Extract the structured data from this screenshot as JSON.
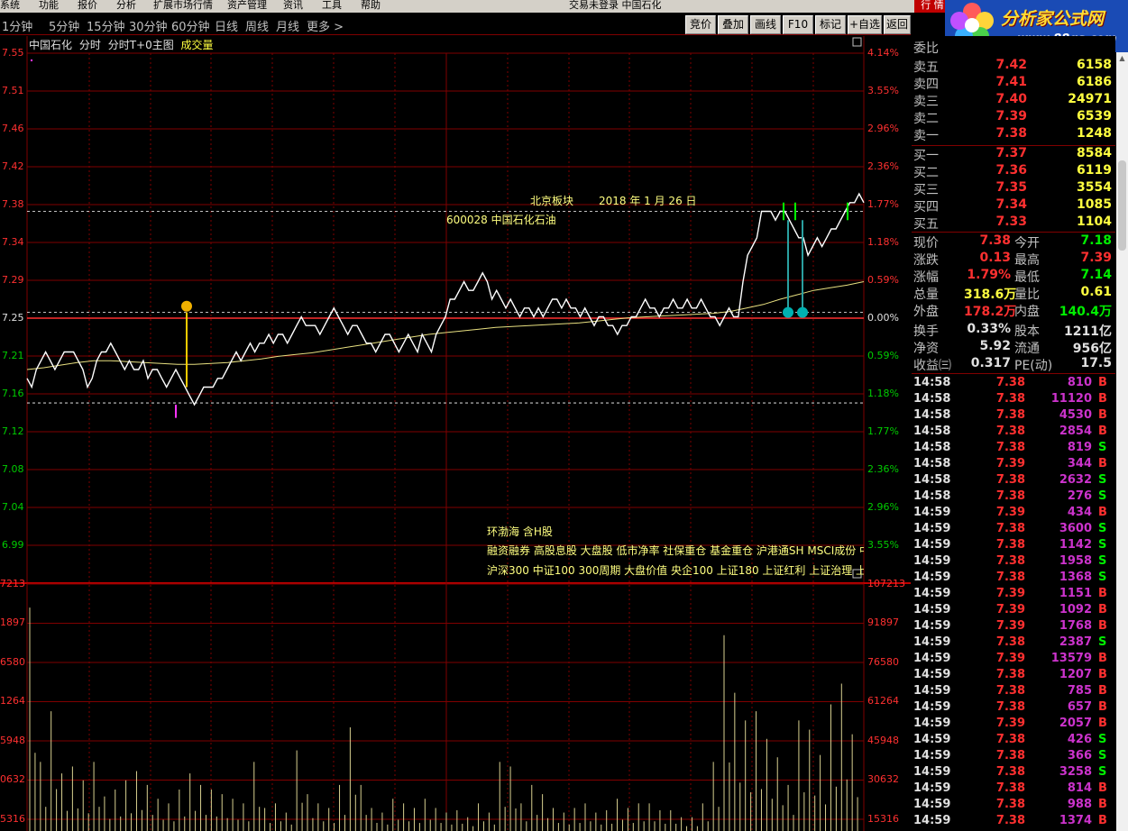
{
  "menu": [
    "系统",
    "功能",
    "报价",
    "分析",
    "扩展市场行情",
    "资产管理",
    "资讯",
    "工具",
    "帮助"
  ],
  "app_title": "交易未登录  中国石化",
  "xingqing_label": "行 情",
  "logo": {
    "text": "分析家公式网",
    "url": "www.88gs.com"
  },
  "toolbar": {
    "periods": [
      "1分钟",
      "5分钟",
      "15分钟",
      "30分钟",
      "60分钟",
      "日线",
      "周线",
      "月线",
      "更多 >"
    ],
    "buttons": [
      "竞价",
      "叠加",
      "画线",
      "F10",
      "标记",
      "+自选",
      "返回"
    ]
  },
  "chart_title": {
    "stock": "中国石化",
    "mode1": "分时",
    "mode2": "分时T+0主图",
    "indicator": "成交量"
  },
  "price_axis": {
    "left": [
      "7.55",
      "7.51",
      "7.46",
      "7.42",
      "7.38",
      "7.34",
      "7.29",
      "7.25",
      "7.21",
      "7.16",
      "7.12",
      "7.08",
      "7.04",
      "6.99"
    ],
    "right": [
      "4.14%",
      "3.55%",
      "2.96%",
      "2.36%",
      "1.77%",
      "1.18%",
      "0.59%",
      "0.00%",
      "0.59%",
      "1.18%",
      "1.77%",
      "2.36%",
      "2.96%",
      "3.55%"
    ]
  },
  "volume_axis": {
    "left": [
      "7213",
      "1897",
      "6580",
      "1264",
      "5948",
      "0632",
      "5316"
    ],
    "right": [
      "107213",
      "91897",
      "76580",
      "61264",
      "45948",
      "30632",
      "15316"
    ]
  },
  "annotations": {
    "beijing": "北京板块",
    "date": "2018 年 1 月 26 日",
    "code": "600028 中国石化石油",
    "sector1": "环渤海 含H股",
    "sector2": "融资融券 高股息股 大盘股 低市净率 社保重仓 基金重仓 沪港通SH MSCI成份 中",
    "sector3": "沪深300 中证100 300周期 大盘价值 央企100 上证180 上证红利 上证治理 上证"
  },
  "chart_data": {
    "type": "line",
    "price_range": [
      6.99,
      7.55
    ],
    "pre_close": 7.25,
    "price": [
      7.18,
      7.17,
      7.19,
      7.2,
      7.21,
      7.2,
      7.19,
      7.2,
      7.21,
      7.21,
      7.21,
      7.2,
      7.19,
      7.17,
      7.18,
      7.2,
      7.21,
      7.21,
      7.22,
      7.21,
      7.2,
      7.19,
      7.2,
      7.19,
      7.19,
      7.2,
      7.18,
      7.19,
      7.19,
      7.18,
      7.17,
      7.18,
      7.19,
      7.18,
      7.17,
      7.16,
      7.15,
      7.16,
      7.17,
      7.17,
      7.17,
      7.18,
      7.18,
      7.19,
      7.2,
      7.21,
      7.2,
      7.21,
      7.22,
      7.21,
      7.22,
      7.22,
      7.23,
      7.22,
      7.23,
      7.23,
      7.22,
      7.23,
      7.24,
      7.25,
      7.24,
      7.24,
      7.24,
      7.23,
      7.24,
      7.25,
      7.26,
      7.25,
      7.24,
      7.23,
      7.24,
      7.24,
      7.23,
      7.22,
      7.22,
      7.21,
      7.22,
      7.23,
      7.23,
      7.22,
      7.21,
      7.22,
      7.23,
      7.22,
      7.21,
      7.23,
      7.22,
      7.21,
      7.23,
      7.24,
      7.25,
      7.27,
      7.27,
      7.28,
      7.29,
      7.28,
      7.28,
      7.29,
      7.3,
      7.29,
      7.27,
      7.28,
      7.27,
      7.26,
      7.27,
      7.26,
      7.25,
      7.26,
      7.26,
      7.25,
      7.26,
      7.25,
      7.26,
      7.27,
      7.27,
      7.26,
      7.27,
      7.26,
      7.26,
      7.25,
      7.26,
      7.25,
      7.24,
      7.25,
      7.25,
      7.24,
      7.24,
      7.23,
      7.24,
      7.24,
      7.25,
      7.25,
      7.26,
      7.27,
      7.26,
      7.26,
      7.25,
      7.26,
      7.26,
      7.27,
      7.26,
      7.26,
      7.27,
      7.26,
      7.26,
      7.27,
      7.26,
      7.25,
      7.25,
      7.24,
      7.25,
      7.26,
      7.25,
      7.25,
      7.29,
      7.32,
      7.33,
      7.34,
      7.37,
      7.37,
      7.37,
      7.36,
      7.37,
      7.37,
      7.36,
      7.35,
      7.34,
      7.34,
      7.32,
      7.33,
      7.34,
      7.33,
      7.34,
      7.35,
      7.35,
      7.36,
      7.37,
      7.38,
      7.38,
      7.39,
      7.38
    ],
    "avg_price": [
      7.19,
      7.192,
      7.195,
      7.198,
      7.2,
      7.2,
      7.199,
      7.198,
      7.197,
      7.196,
      7.196,
      7.197,
      7.198,
      7.2,
      7.202,
      7.205,
      7.207,
      7.209,
      7.212,
      7.215,
      7.218,
      7.221,
      7.224,
      7.227,
      7.23,
      7.232,
      7.234,
      7.236,
      7.238,
      7.239,
      7.24,
      7.241,
      7.242,
      7.243,
      7.245,
      7.247,
      7.249,
      7.25,
      7.251,
      7.252,
      7.253,
      7.254,
      7.256,
      7.26,
      7.264,
      7.27,
      7.275,
      7.28,
      7.283,
      7.286,
      7.29
    ],
    "volume_max": 107213,
    "volume_peaks": [
      97000,
      30000,
      52000,
      25000,
      28000,
      22000,
      30000,
      15000,
      18000,
      22000,
      26000,
      20000,
      14000,
      12000,
      18000,
      25000,
      20000,
      18000,
      16000,
      14000,
      12000,
      30000,
      10000,
      12000,
      8000,
      35000,
      16000,
      12000,
      10000,
      20000,
      45000,
      20000,
      10000,
      8000,
      14000,
      12000,
      10000,
      14000,
      10000,
      8000,
      9000,
      6000,
      12000,
      8000,
      30000,
      28000,
      12000,
      20000,
      16000,
      10000,
      8000,
      10000,
      12000,
      8000,
      9000,
      14000,
      10000,
      12000,
      12000,
      9000,
      9000,
      6000,
      6000,
      12000,
      30000,
      85000,
      60000,
      48000,
      52000,
      40000,
      32000,
      20000,
      48000,
      44000,
      33000,
      55000,
      64000,
      42000
    ]
  },
  "order_book": {
    "header": "委比",
    "sell": [
      {
        "label": "卖五",
        "price": "7.42",
        "vol": "6158"
      },
      {
        "label": "卖四",
        "price": "7.41",
        "vol": "6186"
      },
      {
        "label": "卖三",
        "price": "7.40",
        "vol": "24971"
      },
      {
        "label": "卖二",
        "price": "7.39",
        "vol": "6539"
      },
      {
        "label": "卖一",
        "price": "7.38",
        "vol": "1248"
      }
    ],
    "buy": [
      {
        "label": "买一",
        "price": "7.37",
        "vol": "8584"
      },
      {
        "label": "买二",
        "price": "7.36",
        "vol": "6119"
      },
      {
        "label": "买三",
        "price": "7.35",
        "vol": "3554"
      },
      {
        "label": "买四",
        "price": "7.34",
        "vol": "1085"
      },
      {
        "label": "买五",
        "price": "7.33",
        "vol": "1104"
      }
    ]
  },
  "quote": [
    {
      "l1": "现价",
      "v1": "7.38",
      "c1": "red",
      "l2": "今开",
      "v2": "7.18",
      "c2": "green"
    },
    {
      "l1": "涨跌",
      "v1": "0.13",
      "c1": "red",
      "l2": "最高",
      "v2": "7.39",
      "c2": "red"
    },
    {
      "l1": "涨幅",
      "v1": "1.79%",
      "c1": "red",
      "l2": "最低",
      "v2": "7.14",
      "c2": "green"
    },
    {
      "l1": "总量",
      "v1": "318.6万",
      "c1": "yellow",
      "l2": "量比",
      "v2": "0.61",
      "c2": "yellow"
    },
    {
      "l1": "外盘",
      "v1": "178.2万",
      "c1": "red",
      "l2": "内盘",
      "v2": "140.4万",
      "c2": "green"
    },
    {
      "l1": "换手",
      "v1": "0.33%",
      "c1": "white",
      "l2": "股本",
      "v2": "1211亿",
      "c2": "white"
    },
    {
      "l1": "净资",
      "v1": "5.92",
      "c1": "white",
      "l2": "流通",
      "v2": "956亿",
      "c2": "white"
    },
    {
      "l1": "收益㈢",
      "v1": "0.317",
      "c1": "white",
      "l2": "PE(动)",
      "v2": "17.5",
      "c2": "white"
    }
  ],
  "ticks": [
    {
      "time": "14:58",
      "price": "7.38",
      "vol": "810",
      "bs": "B"
    },
    {
      "time": "14:58",
      "price": "7.38",
      "vol": "11120",
      "bs": "B"
    },
    {
      "time": "14:58",
      "price": "7.38",
      "vol": "4530",
      "bs": "B"
    },
    {
      "time": "14:58",
      "price": "7.38",
      "vol": "2854",
      "bs": "B"
    },
    {
      "time": "14:58",
      "price": "7.38",
      "vol": "819",
      "bs": "S"
    },
    {
      "time": "14:58",
      "price": "7.39",
      "vol": "344",
      "bs": "B"
    },
    {
      "time": "14:58",
      "price": "7.38",
      "vol": "2632",
      "bs": "S"
    },
    {
      "time": "14:58",
      "price": "7.38",
      "vol": "276",
      "bs": "S"
    },
    {
      "time": "14:59",
      "price": "7.39",
      "vol": "434",
      "bs": "B"
    },
    {
      "time": "14:59",
      "price": "7.38",
      "vol": "3600",
      "bs": "S"
    },
    {
      "time": "14:59",
      "price": "7.38",
      "vol": "1142",
      "bs": "S"
    },
    {
      "time": "14:59",
      "price": "7.38",
      "vol": "1958",
      "bs": "S"
    },
    {
      "time": "14:59",
      "price": "7.38",
      "vol": "1368",
      "bs": "S"
    },
    {
      "time": "14:59",
      "price": "7.39",
      "vol": "1151",
      "bs": "B"
    },
    {
      "time": "14:59",
      "price": "7.39",
      "vol": "1092",
      "bs": "B"
    },
    {
      "time": "14:59",
      "price": "7.39",
      "vol": "1768",
      "bs": "B"
    },
    {
      "time": "14:59",
      "price": "7.38",
      "vol": "2387",
      "bs": "S"
    },
    {
      "time": "14:59",
      "price": "7.39",
      "vol": "13579",
      "bs": "B"
    },
    {
      "time": "14:59",
      "price": "7.38",
      "vol": "1207",
      "bs": "B"
    },
    {
      "time": "14:59",
      "price": "7.38",
      "vol": "785",
      "bs": "B"
    },
    {
      "time": "14:59",
      "price": "7.38",
      "vol": "657",
      "bs": "B"
    },
    {
      "time": "14:59",
      "price": "7.39",
      "vol": "2057",
      "bs": "B"
    },
    {
      "time": "14:59",
      "price": "7.38",
      "vol": "426",
      "bs": "S"
    },
    {
      "time": "14:59",
      "price": "7.38",
      "vol": "366",
      "bs": "S"
    },
    {
      "time": "14:59",
      "price": "7.38",
      "vol": "3258",
      "bs": "S"
    },
    {
      "time": "14:59",
      "price": "7.38",
      "vol": "814",
      "bs": "B"
    },
    {
      "time": "14:59",
      "price": "7.38",
      "vol": "988",
      "bs": "B"
    },
    {
      "time": "14:59",
      "price": "7.38",
      "vol": "1374",
      "bs": "B"
    }
  ],
  "colors": {
    "up": "#ff3030",
    "down": "#00ee00",
    "price_line": "#ffffff",
    "avg_line": "#e8e080",
    "volume_bar": "#d8d090",
    "grid": "#800000",
    "tick_vol": "#cc33cc"
  }
}
